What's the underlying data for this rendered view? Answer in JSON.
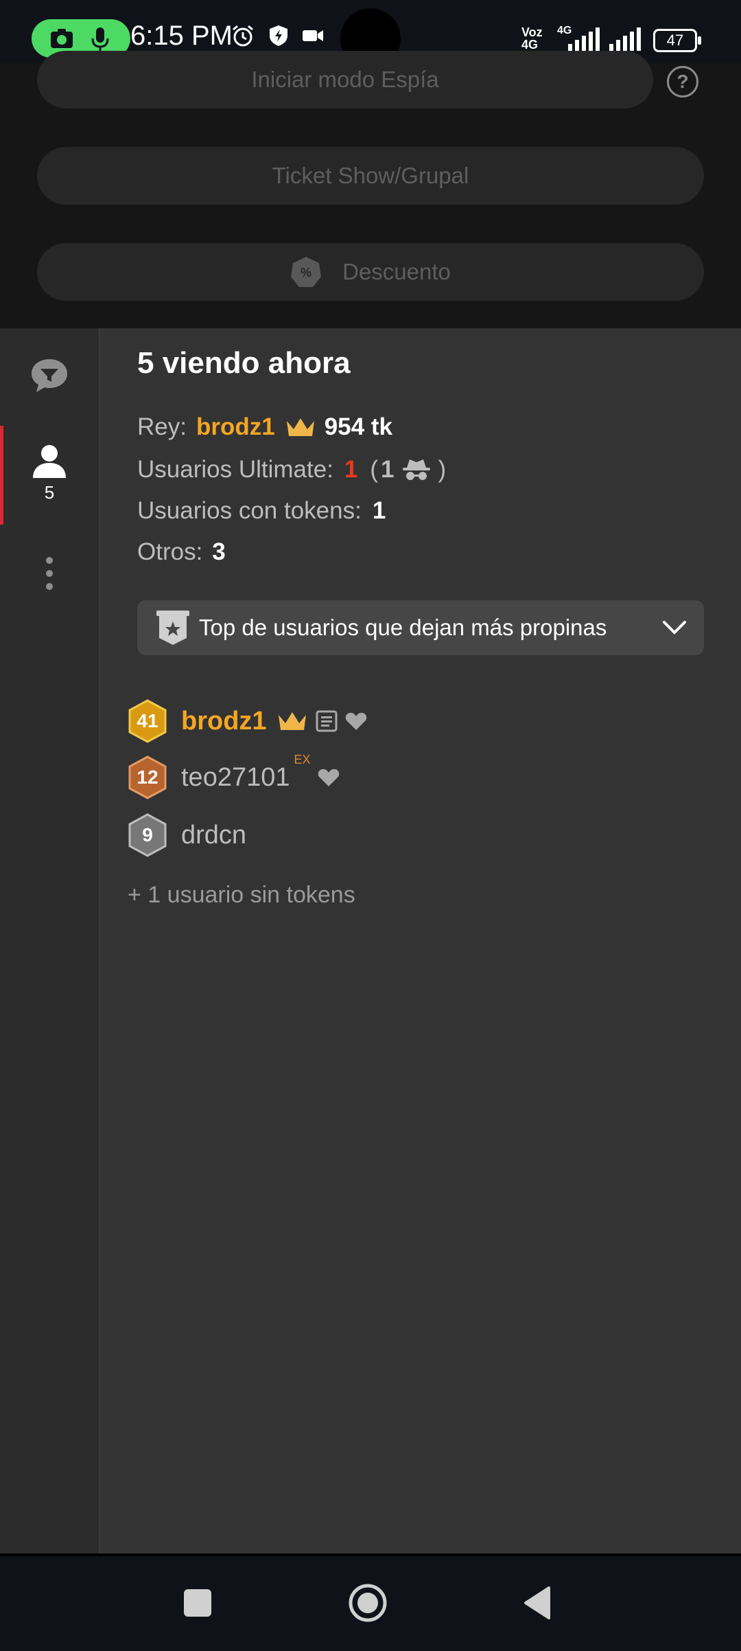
{
  "status_bar": {
    "time": "6:15 PM",
    "network_labels": [
      "Voz",
      "4G",
      "4G"
    ],
    "battery": "47"
  },
  "top_panel": {
    "spy_button": "Iniciar modo Espía",
    "ticket_button": "Ticket Show/Grupal",
    "discount_button": "Descuento"
  },
  "sidebar": {
    "users_count": "5"
  },
  "viewers": {
    "title": "5 viendo ahora",
    "king_label": "Rey:",
    "king_name": "brodz1",
    "king_tokens": "954 tk",
    "ultimate_label": "Usuarios Ultimate:",
    "ultimate_count": "1",
    "ultimate_incognito_open": "(",
    "ultimate_incognito_count": "1",
    "ultimate_incognito_close": ")",
    "tokens_label": "Usuarios con tokens:",
    "tokens_count": "1",
    "others_label": "Otros:",
    "others_count": "3",
    "dropdown_label": "Top de usuarios que dejan más propinas"
  },
  "users": [
    {
      "level": "41",
      "name": "brodz1",
      "color": "#f5a623"
    },
    {
      "level": "12",
      "name": "teo27101",
      "tag": "EX",
      "color": "#bdbdbd"
    },
    {
      "level": "9",
      "name": "drdcn",
      "color": "#bdbdbd"
    }
  ],
  "more_users": "+ 1 usuario sin tokens",
  "colors": {
    "accent_orange": "#f5a623",
    "accent_red": "#e0262f",
    "ultimate_red": "#ea3a1c"
  }
}
